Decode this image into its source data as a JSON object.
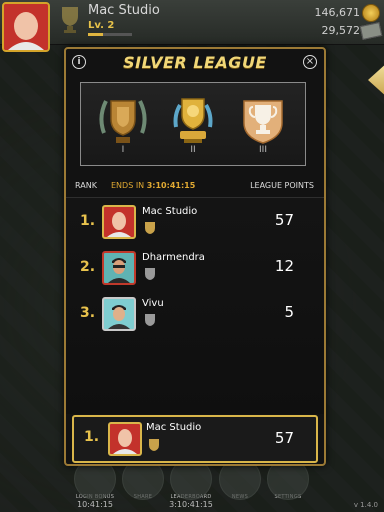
{
  "player": {
    "name": "Mac Studio",
    "level": "Lv. 2",
    "xp_fraction": 0.35,
    "coins": "146,671",
    "cash": "29,572"
  },
  "modal": {
    "title": "SILVER LEAGUE",
    "info_glyph": "i",
    "close_glyph": "×",
    "trophies": [
      {
        "label": "I"
      },
      {
        "label": "II"
      },
      {
        "label": "III"
      }
    ],
    "table": {
      "rank_header": "RANK",
      "ends_label": "ENDS IN",
      "ends_value": "3:10:41:15",
      "points_header": "LEAGUE POINTS"
    },
    "entries": [
      {
        "rank": "1.",
        "name": "Mac Studio",
        "points": "57"
      },
      {
        "rank": "2.",
        "name": "Dharmendra",
        "points": "12"
      },
      {
        "rank": "3.",
        "name": "Vivu",
        "points": "5"
      }
    ],
    "current_player": {
      "rank": "1.",
      "name": "Mac Studio",
      "points": "57"
    }
  },
  "bottom_nav": {
    "items": [
      {
        "label": "LOGIN BONUS",
        "timer": "10:41:15"
      },
      {
        "label": "SHARE",
        "timer": ""
      },
      {
        "label": "LEADERBOARD",
        "timer": "3:10:41:15"
      },
      {
        "label": "NEWS",
        "timer": ""
      },
      {
        "label": "SETTINGS",
        "timer": ""
      }
    ],
    "version": "v 1.4.0"
  },
  "colors": {
    "accent_gold": "#f1d777",
    "frame_gold": "#9c7a35",
    "timer_orange": "#e0a932"
  }
}
